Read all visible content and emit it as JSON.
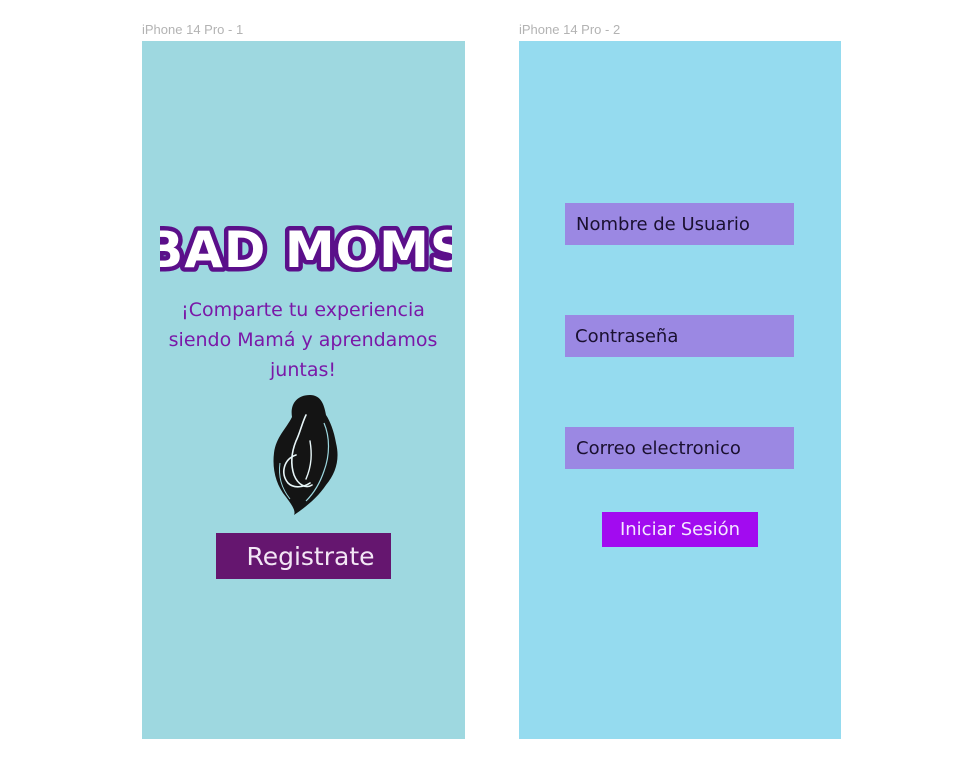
{
  "frames": [
    {
      "label": "iPhone 14 Pro - 1",
      "background": "#9ed8e0",
      "logo_text": "BAD MOMS",
      "logo_colors": {
        "fill": "#ffffff",
        "outline": "#5b0f8a"
      },
      "tagline": "¡Comparte tu experiencia siendo Mamá y aprendamos juntas!",
      "illustration": "pregnant-woman-silhouette-icon",
      "register_button": {
        "label": "Registrate",
        "color": "#65166f"
      }
    },
    {
      "label": "iPhone 14 Pro - 2",
      "background": "#95dbef",
      "fields": [
        {
          "label": "Nombre de Usuario"
        },
        {
          "label": "Contraseña"
        },
        {
          "label": "Correo electronico"
        }
      ],
      "field_color": "#9b88e3",
      "login_button": {
        "label": "Iniciar Sesión",
        "color": "#a20bf0"
      }
    }
  ]
}
